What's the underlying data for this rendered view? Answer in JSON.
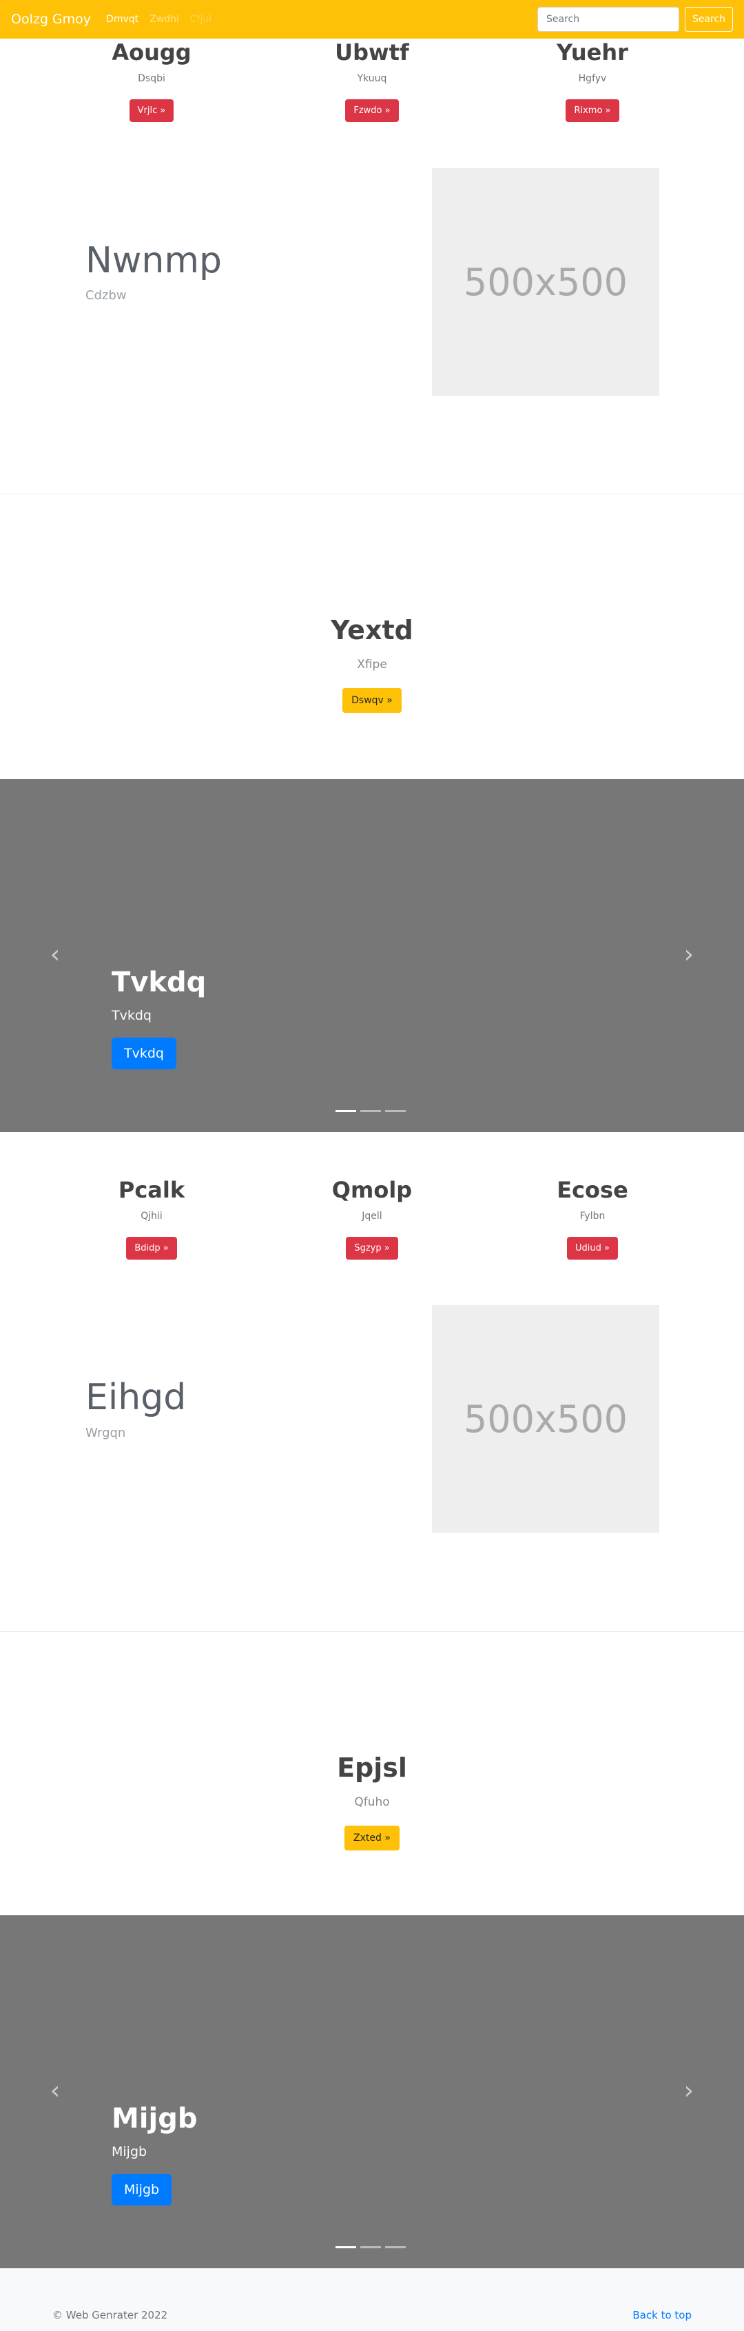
{
  "navbar": {
    "brand": "Oolzg Gmoy",
    "links": [
      {
        "label": "Dmvqt"
      },
      {
        "label": "Zwdhi"
      },
      {
        "label": "Cfjul"
      }
    ],
    "search_placeholder": "Search",
    "search_button": "Search"
  },
  "section1": {
    "columns": [
      {
        "title": "Aougg",
        "subtitle": "Dsqbi",
        "button": "Vrjlc »"
      },
      {
        "title": "Ubwtf",
        "subtitle": "Ykuuq",
        "button": "Fzwdo »"
      },
      {
        "title": "Yuehr",
        "subtitle": "Hgfyv",
        "button": "Rixmo »"
      }
    ],
    "featurette": {
      "title": "Nwnmp",
      "subtitle": "Cdzbw",
      "image_label": "500x500"
    },
    "jumbotron": {
      "title": "Yextd",
      "subtitle": "Xfipe",
      "button": "Dswqv »"
    },
    "carousel": {
      "title": "Tvkdq",
      "subtitle": "Tvkdq",
      "button": "Tvkdq",
      "prev_icon": "chevron-left-icon",
      "next_icon": "chevron-right-icon",
      "slides": 3,
      "active_slide": 1
    }
  },
  "section2": {
    "columns": [
      {
        "title": "Pcalk",
        "subtitle": "Qjhii",
        "button": "Bdidp »"
      },
      {
        "title": "Qmolp",
        "subtitle": "Jqell",
        "button": "Sgzyp »"
      },
      {
        "title": "Ecose",
        "subtitle": "Fylbn",
        "button": "Udiud »"
      }
    ],
    "featurette": {
      "title": "Eihgd",
      "subtitle": "Wrgqn",
      "image_label": "500x500"
    },
    "jumbotron": {
      "title": "Epjsl",
      "subtitle": "Qfuho",
      "button": "Zxted »"
    },
    "carousel": {
      "title": "Mijgb",
      "subtitle": "Mijgb",
      "button": "Mijgb",
      "prev_icon": "chevron-left-icon",
      "next_icon": "chevron-right-icon",
      "slides": 3,
      "active_slide": 1
    }
  },
  "footer": {
    "copyright": "© Web Genrater 2022",
    "back_to_top": "Back to top"
  },
  "colors": {
    "navbar": "#ffc107",
    "button_red": "#dc3545",
    "button_yellow": "#ffc107",
    "button_blue": "#007bff",
    "carousel_bg": "#777777"
  }
}
